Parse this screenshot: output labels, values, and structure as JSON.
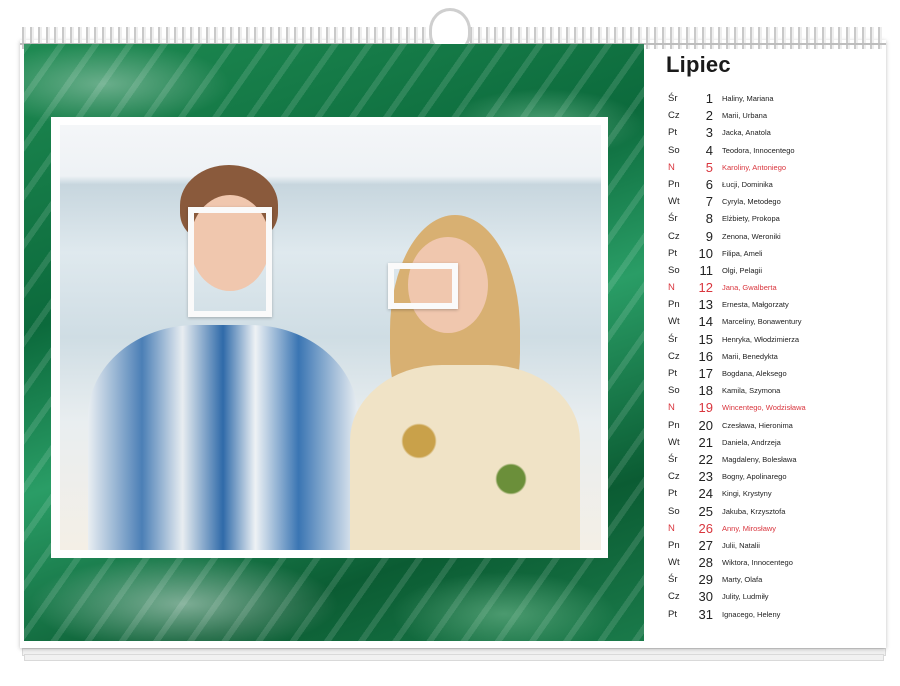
{
  "calendar": {
    "month": "Lipiec",
    "days": [
      {
        "dow": "Śr",
        "day": "1",
        "names": "Haliny, Mariana",
        "sunday": false
      },
      {
        "dow": "Cz",
        "day": "2",
        "names": "Marii, Urbana",
        "sunday": false
      },
      {
        "dow": "Pt",
        "day": "3",
        "names": "Jacka, Anatola",
        "sunday": false
      },
      {
        "dow": "So",
        "day": "4",
        "names": "Teodora, Innocentego",
        "sunday": false
      },
      {
        "dow": "N",
        "day": "5",
        "names": "Karoliny, Antoniego",
        "sunday": true
      },
      {
        "dow": "Pn",
        "day": "6",
        "names": "Łucji, Dominika",
        "sunday": false
      },
      {
        "dow": "Wt",
        "day": "7",
        "names": "Cyryla, Metodego",
        "sunday": false
      },
      {
        "dow": "Śr",
        "day": "8",
        "names": "Elżbiety, Prokopa",
        "sunday": false
      },
      {
        "dow": "Cz",
        "day": "9",
        "names": "Zenona, Weroniki",
        "sunday": false
      },
      {
        "dow": "Pt",
        "day": "10",
        "names": "Filipa, Ameli",
        "sunday": false
      },
      {
        "dow": "So",
        "day": "11",
        "names": "Olgi, Pelagii",
        "sunday": false
      },
      {
        "dow": "N",
        "day": "12",
        "names": "Jana, Gwalberta",
        "sunday": true
      },
      {
        "dow": "Pn",
        "day": "13",
        "names": "Ernesta, Małgorzaty",
        "sunday": false
      },
      {
        "dow": "Wt",
        "day": "14",
        "names": "Marceliny, Bonawentury",
        "sunday": false
      },
      {
        "dow": "Śr",
        "day": "15",
        "names": "Henryka, Włodzimierza",
        "sunday": false
      },
      {
        "dow": "Cz",
        "day": "16",
        "names": "Marii, Benedykta",
        "sunday": false
      },
      {
        "dow": "Pt",
        "day": "17",
        "names": "Bogdana, Aleksego",
        "sunday": false
      },
      {
        "dow": "So",
        "day": "18",
        "names": "Kamila, Szymona",
        "sunday": false
      },
      {
        "dow": "N",
        "day": "19",
        "names": "Wincentego, Wodzisława",
        "sunday": true
      },
      {
        "dow": "Pn",
        "day": "20",
        "names": "Czesława, Hieronima",
        "sunday": false
      },
      {
        "dow": "Wt",
        "day": "21",
        "names": "Daniela, Andrzeja",
        "sunday": false
      },
      {
        "dow": "Śr",
        "day": "22",
        "names": "Magdaleny, Bolesława",
        "sunday": false
      },
      {
        "dow": "Cz",
        "day": "23",
        "names": "Bogny, Apolinarego",
        "sunday": false
      },
      {
        "dow": "Pt",
        "day": "24",
        "names": "Kingi, Krystyny",
        "sunday": false
      },
      {
        "dow": "So",
        "day": "25",
        "names": "Jakuba, Krzysztofa",
        "sunday": false
      },
      {
        "dow": "N",
        "day": "26",
        "names": "Anny, Mirosławy",
        "sunday": true
      },
      {
        "dow": "Pn",
        "day": "27",
        "names": "Julii, Natalii",
        "sunday": false
      },
      {
        "dow": "Wt",
        "day": "28",
        "names": "Wiktora, Innocentego",
        "sunday": false
      },
      {
        "dow": "Śr",
        "day": "29",
        "names": "Marty, Olafa",
        "sunday": false
      },
      {
        "dow": "Cz",
        "day": "30",
        "names": "Julity, Ludmiły",
        "sunday": false
      },
      {
        "dow": "Pt",
        "day": "31",
        "names": "Ignacego, Heleny",
        "sunday": false
      }
    ]
  },
  "colors": {
    "sunday": "#d9363e",
    "background_green": "#0c6a3c"
  }
}
